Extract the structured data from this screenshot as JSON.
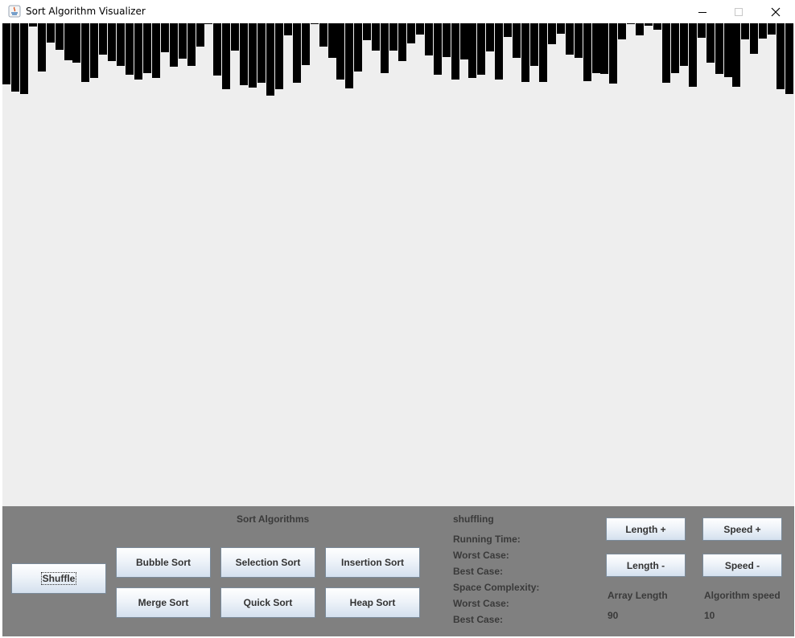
{
  "window": {
    "title": "Sort Algorithm Visualizer"
  },
  "array_values": [
    76,
    85,
    88,
    4,
    60,
    24,
    33,
    46,
    49,
    73,
    68,
    39,
    47,
    53,
    64,
    70,
    62,
    68,
    36,
    54,
    44,
    53,
    29,
    0,
    65,
    82,
    34,
    77,
    80,
    74,
    90,
    82,
    15,
    74,
    52,
    0,
    29,
    43,
    70,
    81,
    60,
    21,
    34,
    62,
    34,
    47,
    25,
    14,
    40,
    64,
    42,
    70,
    45,
    68,
    64,
    35,
    70,
    17,
    43,
    73,
    53,
    73,
    26,
    13,
    39,
    43,
    72,
    62,
    63,
    75,
    20,
    0,
    15,
    3,
    8,
    74,
    62,
    53,
    79,
    18,
    49,
    63,
    67,
    79,
    20,
    38,
    19,
    14,
    82,
    88
  ],
  "colors": {
    "bar": "#000000",
    "canvas": "#eeeeee",
    "panel": "#808080"
  },
  "panel": {
    "shuffle_label": "Shuffle",
    "sort_title": "Sort Algorithms",
    "algorithms": [
      "Bubble Sort",
      "Selection Sort",
      "Insertion Sort",
      "Merge Sort",
      "Quick Sort",
      "Heap Sort"
    ],
    "status": "shuffling",
    "running_time_label": "Running Time:",
    "running_worst_label": "Worst Case:",
    "running_best_label": "Best Case:",
    "space_label": "Space Complexity:",
    "space_worst_label": "Worst Case:",
    "space_best_label": "Best Case:",
    "length_plus": "Length +",
    "length_minus": "Length -",
    "speed_plus": "Speed +",
    "speed_minus": "Speed -",
    "array_length_label": "Array Length",
    "array_length_value": "90",
    "speed_label": "Algorithm speed",
    "speed_value": "10"
  }
}
